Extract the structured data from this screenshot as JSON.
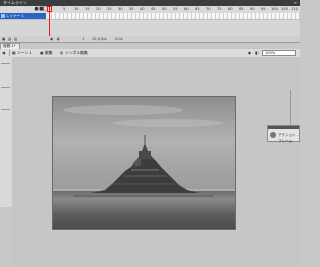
{
  "timeline": {
    "title": "タイムライン",
    "close": "≡",
    "layer_name": "レイヤー 1",
    "ruler_ticks": [
      "1",
      "5",
      "10",
      "15",
      "20",
      "25",
      "30",
      "35",
      "40",
      "45",
      "50",
      "55",
      "60",
      "65",
      "70",
      "75",
      "80",
      "85",
      "90",
      "95",
      "100",
      "105",
      "110"
    ],
    "footer": {
      "current_frame": "1",
      "fps": "12.0 fps",
      "time": "0.0s"
    }
  },
  "document": {
    "tab": "無題-1*",
    "scene_label": "シーン 1",
    "back_label": "編集",
    "symbol_label": "シンボル編集",
    "zoom": "100%"
  },
  "actions_panel": {
    "label": "アクション - フレーム"
  },
  "colors": {
    "playhead": "#e41b1b",
    "layer_selected": "#2d62c7",
    "timeline_header": "#3c3c3c"
  }
}
